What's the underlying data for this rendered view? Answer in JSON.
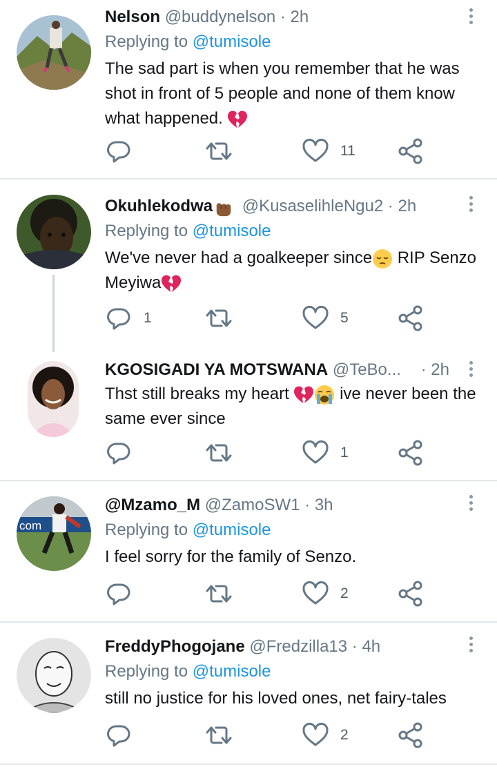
{
  "tweets": [
    {
      "name": "Nelson",
      "handle": "@buddynelson",
      "time": "· 2h",
      "reply_prefix": "Replying to ",
      "reply_to": "@tumisole",
      "text": "The sad part is when you remember that he was shot in front of 5 people and none of them know what happened.",
      "replies": "",
      "likes": "11"
    },
    {
      "name": "Okuhlekodwa",
      "handle": "@KusaselihleNgu2",
      "time": "· 2h",
      "reply_prefix": "Replying to ",
      "reply_to": "@tumisole",
      "text_a": "We've never had a goalkeeper since",
      "text_b": " RIP Senzo Meyiwa",
      "replies": "1",
      "likes": "5"
    },
    {
      "name": "KGOSIGADI YA MOTSWANA",
      "handle": "@TeBo...",
      "time": "· 2h",
      "text_a": "Thst still breaks my heart ",
      "text_b": " ive never been the same ever since",
      "replies": "",
      "likes": "1"
    },
    {
      "name": "@Mzamo_M",
      "handle": "@ZamoSW1",
      "time": "· 3h",
      "reply_prefix": "Replying to ",
      "reply_to": "@tumisole",
      "text": "I feel sorry for the family of Senzo.",
      "replies": "",
      "likes": "2",
      "avatar_text": "com"
    },
    {
      "name": "FreddyPhogojane",
      "handle": "@Fredzilla13",
      "time": "· 4h",
      "reply_prefix": "Replying to ",
      "reply_to": "@tumisole",
      "text": "still no justice for his loved ones, net fairy-tales",
      "replies": "",
      "likes": "2"
    }
  ],
  "icons": {
    "reply": "reply-icon",
    "retweet": "retweet-icon",
    "like": "heart-icon",
    "share": "share-icon",
    "more": "more-vertical-icon",
    "broken_heart": "broken-heart-emoji",
    "pensive": "pensive-face-emoji",
    "crying": "loudly-crying-face-emoji",
    "fist": "raised-fist-emoji"
  },
  "colors": {
    "mention": "#1b95e0",
    "secondary_text": "#657786",
    "icon": "#657786",
    "separator": "#e1e8ed",
    "broken_heart": "#e0245e"
  }
}
